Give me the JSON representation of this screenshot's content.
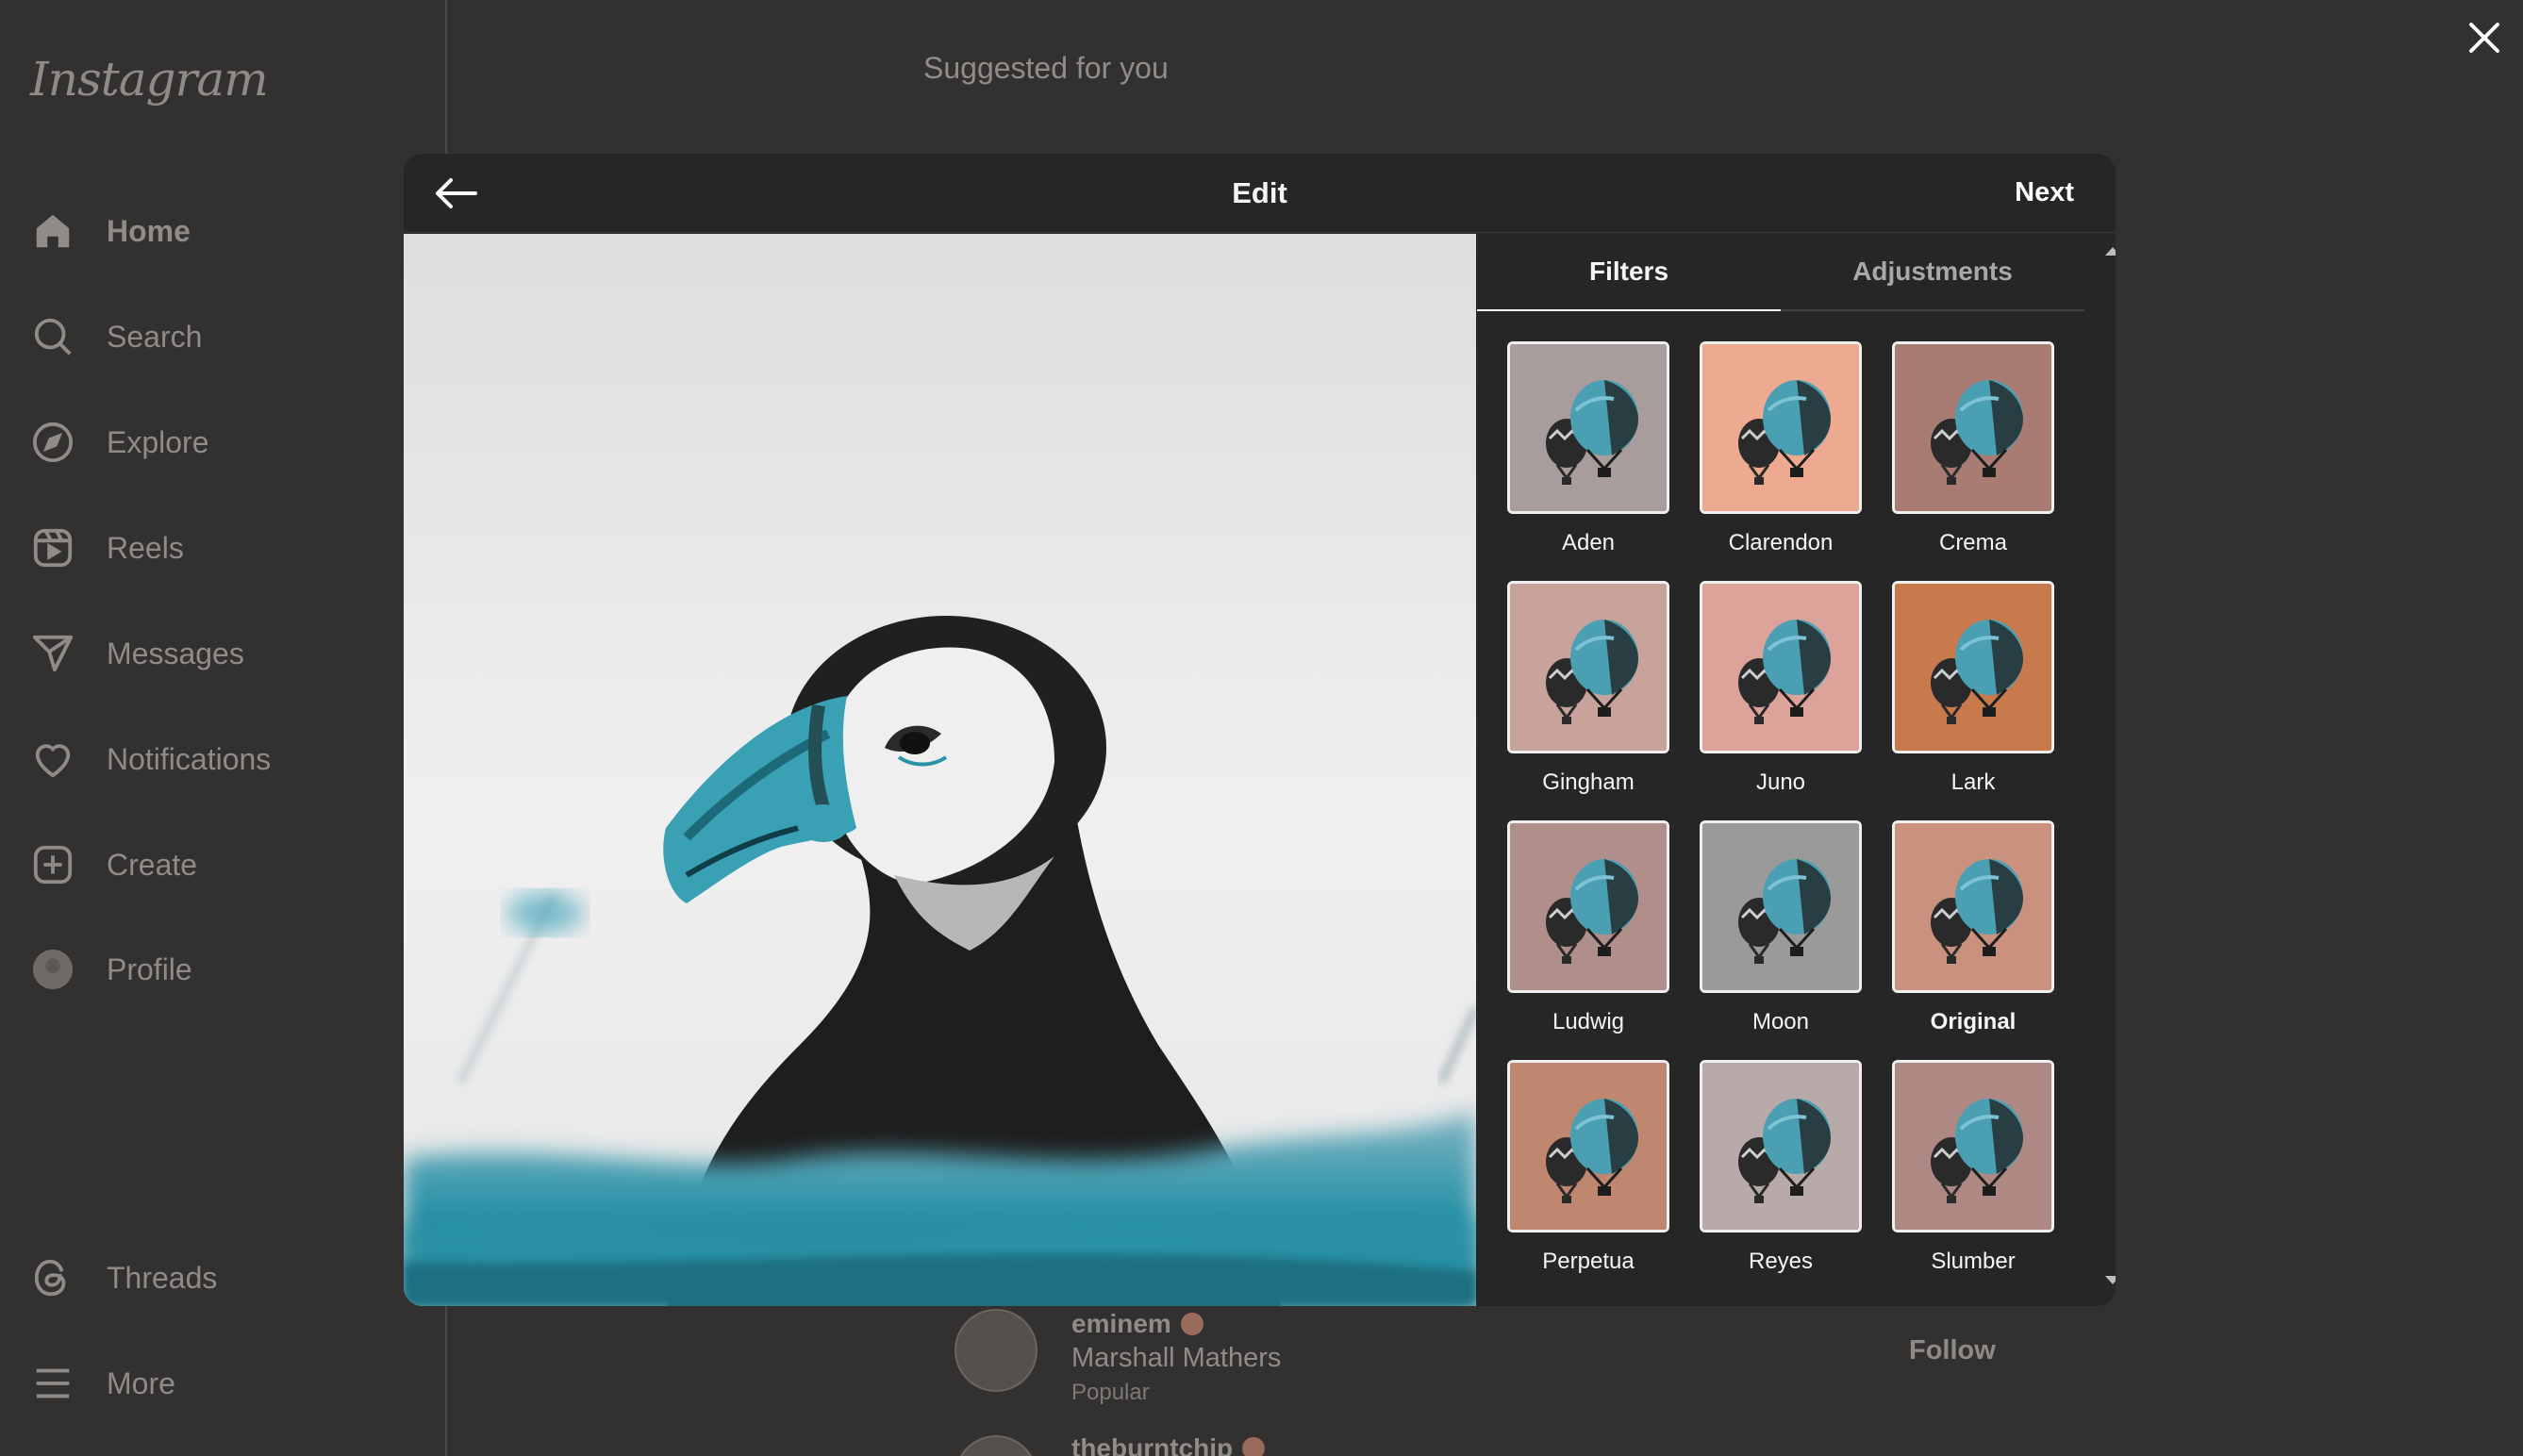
{
  "sidebar": {
    "logo": "Instagram",
    "items": [
      {
        "label": "Home",
        "icon": "home-icon"
      },
      {
        "label": "Search",
        "icon": "search-icon"
      },
      {
        "label": "Explore",
        "icon": "compass-icon"
      },
      {
        "label": "Reels",
        "icon": "reels-icon"
      },
      {
        "label": "Messages",
        "icon": "send-icon"
      },
      {
        "label": "Notifications",
        "icon": "heart-icon"
      },
      {
        "label": "Create",
        "icon": "plus-square-icon"
      },
      {
        "label": "Profile",
        "icon": "avatar"
      },
      {
        "label": "Threads",
        "icon": "threads-icon"
      },
      {
        "label": "More",
        "icon": "menu-icon"
      }
    ]
  },
  "suggested": {
    "title": "Suggested for you",
    "users": [
      {
        "username": "eminem",
        "name": "Marshall Mathers",
        "meta": "Popular",
        "verified": true
      },
      {
        "username": "theburntchip",
        "verified": true
      }
    ],
    "follow_label": "Follow"
  },
  "modal": {
    "title": "Edit",
    "next_label": "Next",
    "tabs": [
      {
        "label": "Filters",
        "active": true
      },
      {
        "label": "Adjustments",
        "active": false
      }
    ],
    "filters": [
      {
        "name": "Aden",
        "bg": "#a89d9c"
      },
      {
        "name": "Clarendon",
        "bg": "#eeaa90"
      },
      {
        "name": "Crema",
        "bg": "#a87c72"
      },
      {
        "name": "Gingham",
        "bg": "#c7a39c"
      },
      {
        "name": "Juno",
        "bg": "#dca39a"
      },
      {
        "name": "Lark",
        "bg": "#c97a4c"
      },
      {
        "name": "Ludwig",
        "bg": "#b08e89"
      },
      {
        "name": "Moon",
        "bg": "#9a9a9a"
      },
      {
        "name": "Original",
        "bg": "#c9917e"
      },
      {
        "name": "Perpetua",
        "bg": "#bf8670"
      },
      {
        "name": "Reyes",
        "bg": "#b8aaa8"
      },
      {
        "name": "Slumber",
        "bg": "#ae8883"
      }
    ],
    "selected_filter": "Original"
  },
  "colors": {
    "background": "#333130",
    "modal": "#262626",
    "accent_blue": "#2a93a8"
  }
}
